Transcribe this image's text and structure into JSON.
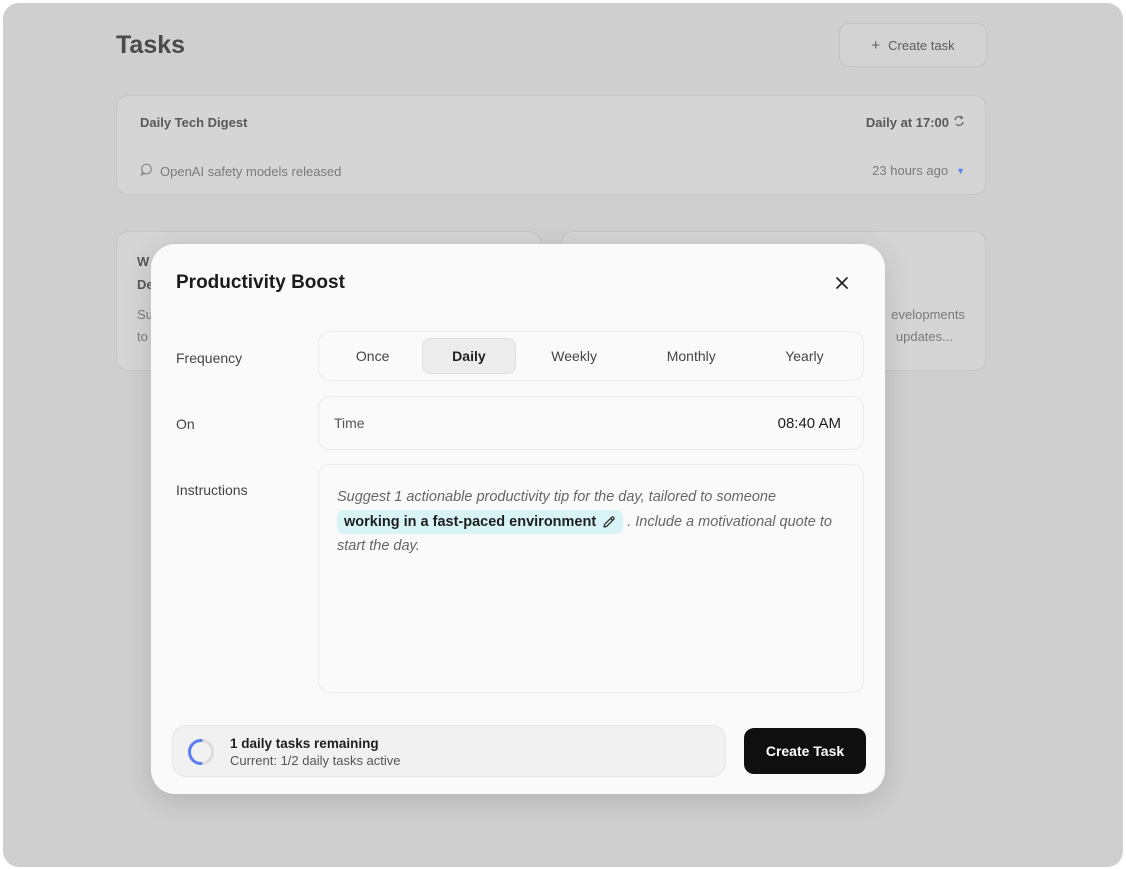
{
  "background": {
    "page_title": "Tasks",
    "create_button_label": "Create task",
    "cards": [
      {
        "title": "Daily Tech Digest",
        "schedule": "Daily at 17:00",
        "latest": "OpenAI safety models released",
        "time_ago": "23 hours ago"
      },
      {
        "partial_lines": [
          "W",
          "De",
          "Su",
          "to"
        ]
      },
      {
        "partial_lines": [
          "evelopments",
          "updates..."
        ]
      }
    ]
  },
  "dialog": {
    "title": "Productivity Boost",
    "frequency": {
      "label": "Frequency",
      "options": [
        "Once",
        "Daily",
        "Weekly",
        "Monthly",
        "Yearly"
      ],
      "selected": "Daily"
    },
    "on": {
      "label": "On",
      "field_label": "Time",
      "value": "08:40 AM"
    },
    "instructions": {
      "label": "Instructions",
      "text_before": "Suggest 1 actionable productivity tip for the day, tailored to someone",
      "chip": "working in a fast-paced environment",
      "text_after": ". Include a motivational quote to start the day."
    },
    "quota": {
      "remaining": "1 daily tasks remaining",
      "current": "Current: 1/2 daily tasks active"
    },
    "create_button_label": "Create Task"
  },
  "colors": {
    "accent_blue": "#5b7ff0",
    "chip_background": "#d9f4f6",
    "primary_button": "#0f0f0f",
    "overlay": "#cfcfcf"
  }
}
